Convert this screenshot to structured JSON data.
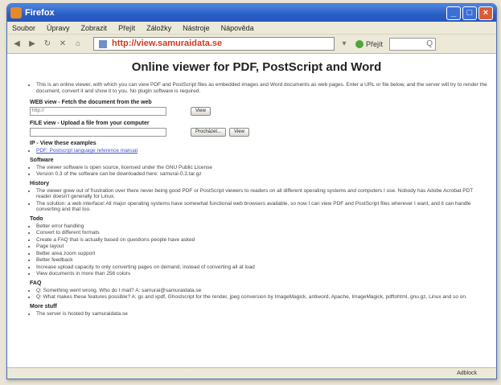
{
  "window": {
    "title": "Firefox"
  },
  "menu": [
    "Soubor",
    "Úpravy",
    "Zobrazit",
    "Přejít",
    "Záložky",
    "Nástroje",
    "Nápověda"
  ],
  "nav": {
    "url": "http://view.samuraidata.se",
    "go_label": "Přejít",
    "search_placeholder": "Q"
  },
  "page": {
    "title": "Online viewer for PDF, PostScript and Word",
    "intro": "This is an online viewer, with which you can view PDF and PostScript files as embedded images and Word documents as web pages. Enter a URL or file below, and the server will try to render the document, convert it and show it to you. No plugin software is required.",
    "web_view": {
      "heading": "WEB view - Fetch the document from the web",
      "input_value": "http://",
      "button": "View"
    },
    "file_view": {
      "heading": "FILE view - Upload a file from your computer",
      "browse_button": "Procházet...",
      "view_button": "View"
    },
    "examples": {
      "heading": "IP - View these examples",
      "items": [
        "PDF: Postscript language reference manual"
      ]
    },
    "software": {
      "heading": "Software",
      "items": [
        "The viewer software is open source, licensed under the GNU Public License",
        "Version 0.3 of the software can be downloaded here: samurai-0.3.tar.gz"
      ]
    },
    "history": {
      "heading": "History",
      "items": [
        "The viewer grew out of frustration over there never being good PDF or PostScript viewers to readers on all different operating systems and computers I use. Nobody has Adobe Acrobat PDT reader doesn't generally for Linux.",
        "The solution: a web interface! All major operating systems have somewhat functional web browsers available, so now I can view PDF and PostScript files wherever I want, and it can handle converting and that too."
      ]
    },
    "todo": {
      "heading": "Todo",
      "items": [
        "Better error handling",
        "Convert to different formats",
        "Create a FAQ that is actually based on questions people have asked",
        "Page layout",
        "Better area zoom support",
        "Better feedback",
        "Increase upload capacity to only converting pages on demand, instead of converting all at load",
        "View documents in more than 256 colors"
      ]
    },
    "faq": {
      "heading": "FAQ",
      "items": [
        "Q: Something went wrong. Who do I mail? A: samurai@samuraidata.se",
        "Q: What makes these features possible? A: gs and xpdf, Ghostscript for the render, jpeg conversion by ImageMagick, antiword, Apache, ImageMagick, pdftohtml, gnu.gz, Linux and so on."
      ]
    },
    "about": {
      "heading": "More stuff",
      "items": [
        "The server is hosted by samuraidata.se"
      ]
    }
  },
  "status": {
    "left": "",
    "right": "Adblock"
  }
}
